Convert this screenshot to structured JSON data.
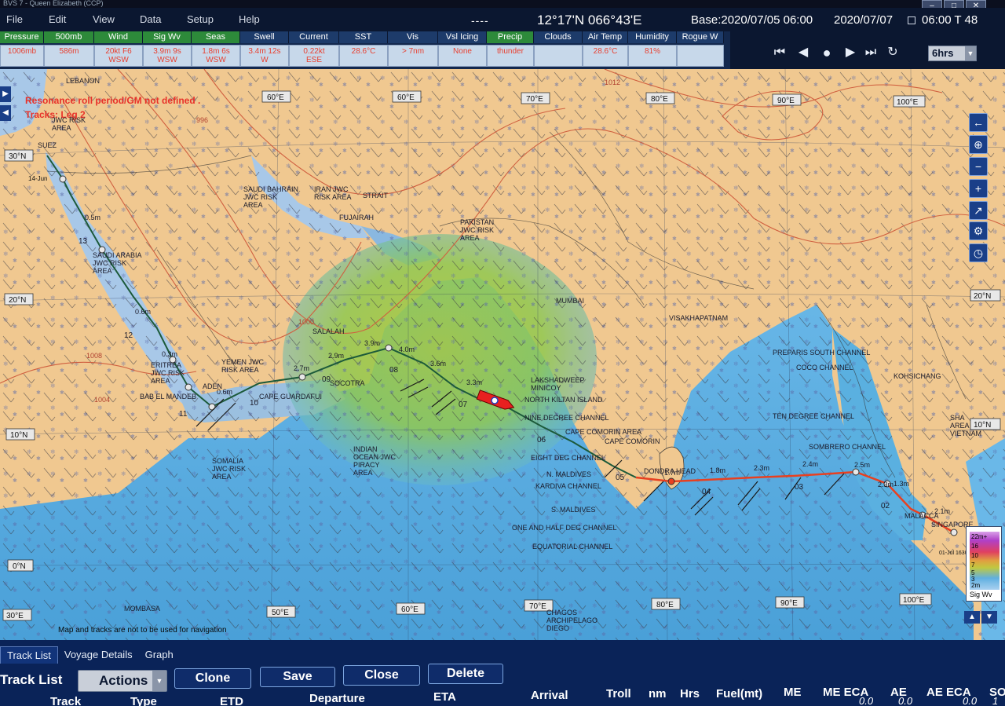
{
  "title_bar": {
    "text": "BVS 7 - Queen Elizabeth (CCP)",
    "buttons": [
      "–",
      "□",
      "✕"
    ]
  },
  "menu": [
    "File",
    "Edit",
    "View",
    "Data",
    "Setup",
    "Help"
  ],
  "status": {
    "indicator": "----",
    "position": "12°17'N 066°43'E",
    "base": "Base:2020/07/05 06:00",
    "date": "2020/07/07",
    "time": "06:00 T 48"
  },
  "params": [
    {
      "label": "Pressure",
      "value": "1006mb",
      "active": true
    },
    {
      "label": "500mb",
      "value": "586m",
      "active": true
    },
    {
      "label": "Wind",
      "value": "20kt F6\nWSW",
      "active": true
    },
    {
      "label": "Sig Wv",
      "value": "3.9m 9s\nWSW",
      "active": true
    },
    {
      "label": "Seas",
      "value": "1.8m 6s\nWSW",
      "active": true
    },
    {
      "label": "Swell",
      "value": "3.4m 12s\nW",
      "active": false
    },
    {
      "label": "Current",
      "value": "0.22kt\nESE",
      "active": false
    },
    {
      "label": "SST",
      "value": "28.6°C",
      "active": false
    },
    {
      "label": "Vis",
      "value": "> 7nm",
      "active": false
    },
    {
      "label": "Vsl Icing",
      "value": "None",
      "active": false
    },
    {
      "label": "Precip",
      "value": "thunder",
      "active": true
    },
    {
      "label": "Clouds",
      "value": "",
      "active": false
    },
    {
      "label": "Air Temp",
      "value": "28.6°C",
      "active": false
    },
    {
      "label": "Humidity",
      "value": "81%",
      "active": false
    },
    {
      "label": "Rogue W",
      "value": "",
      "active": false
    }
  ],
  "playback": {
    "step": "6hrs"
  },
  "map": {
    "warnings": [
      "Resonance roll period/GM not defined .",
      "Tracks: Leg 2"
    ],
    "footer_note": "Map and tracks are not to be used for navigation",
    "lon_labels": [
      "60°E",
      "60°E",
      "70°E",
      "80°E",
      "90°E",
      "100°E"
    ],
    "lon_labels_bottom": [
      "50°E",
      "60°E",
      "70°E",
      "80°E",
      "90°E",
      "100°E"
    ],
    "lat_labels": [
      "30°N",
      "20°N",
      "10°N",
      "0°N",
      "30°E"
    ],
    "lat_labels_right": [
      "20°N",
      "10°N"
    ],
    "places": [
      {
        "name": "LEBANON",
        "icon": "place"
      },
      {
        "name": "JWC RISK\nAREA"
      },
      {
        "name": "SUEZ"
      },
      {
        "name": "SAUDI BAHRAIN\nJWC RISK\nAREA"
      },
      {
        "name": "IRAN JWC\nRISK AREA"
      },
      {
        "name": "STRAIT"
      },
      {
        "name": "FUJAIRAH"
      },
      {
        "name": "PAKISTAN\nJWC RISK\nAREA"
      },
      {
        "name": "SAUDI ARABIA\nJWC RISK\nAREA"
      },
      {
        "name": "MUMBAI"
      },
      {
        "name": "VISAKHAPATNAM"
      },
      {
        "name": "SALALAH"
      },
      {
        "name": "YEMEN JWC\nRISK AREA"
      },
      {
        "name": "ERITREA\nJWC RISK\nAREA"
      },
      {
        "name": "BAB EL MANDEB"
      },
      {
        "name": "ADEN"
      },
      {
        "name": "SOCOTRA"
      },
      {
        "name": "CAPE GUARDAFUI"
      },
      {
        "name": "LAKSHADWEEP\nMINICOY"
      },
      {
        "name": "NORTH KILTAN ISLAND"
      },
      {
        "name": "NINE DEGREE CHANNEL"
      },
      {
        "name": "CAPE COMORIN AREA"
      },
      {
        "name": "CAPE COMORIN"
      },
      {
        "name": "EIGHT DEG CHANNEL"
      },
      {
        "name": "N. MALDIVES"
      },
      {
        "name": "KARDIVA CHANNEL"
      },
      {
        "name": "S. MALDIVES"
      },
      {
        "name": "ONE AND HALF DEG CHANNEL"
      },
      {
        "name": "EQUATORIAL CHANNEL"
      },
      {
        "name": "CHAGOS\nARCHIPELAGO\nDIEGO"
      },
      {
        "name": "SOMALIA\nJWC RISK\nAREA"
      },
      {
        "name": "INDIAN\nOCEAN JWC\nPIRACY\nAREA"
      },
      {
        "name": "PREPARIS SOUTH CHANNEL"
      },
      {
        "name": "COCO CHANNEL"
      },
      {
        "name": "TEN DEGREE CHANNEL"
      },
      {
        "name": "SOMBRERO CHANNEL"
      },
      {
        "name": "KOHSICHANG"
      },
      {
        "name": "SHA\nAREA\nVIETNAM"
      },
      {
        "name": "SINGAPORE"
      },
      {
        "name": "MALACCA"
      },
      {
        "name": "DONDRA HEAD"
      },
      {
        "name": "MOMBASA"
      }
    ],
    "leg_numbers": [
      "13",
      "12",
      "11",
      "10",
      "09",
      "08",
      "07",
      "06",
      "05",
      "04",
      "03",
      "02"
    ],
    "wave_labels": [
      "0.5m",
      "0.6m",
      "0.3m",
      "0.6m",
      "2.9m",
      "3.9m",
      "4.0m",
      "3.6m",
      "3.3m",
      "2.7m",
      "2.3m",
      "1.8m",
      "1.7m",
      "2.3m",
      "2.4m",
      "2.5m",
      "1.3m",
      "2.1m"
    ],
    "track_date_start": "14-Jun",
    "track_date_end": "01-Jul 1630",
    "isobars": [
      "1012",
      "1000",
      "996",
      "1008",
      "1004"
    ]
  },
  "legend": {
    "title": "Sig Wv",
    "ticks": [
      "22m+",
      "16",
      "10",
      "7",
      "5",
      "3",
      "2m"
    ]
  },
  "bottom": {
    "tabs": [
      "Track List",
      "Voyage Details",
      "Graph"
    ],
    "active_tab": "Track List",
    "panel_title": "Track List",
    "actions_label": "Actions",
    "buttons": [
      "Clone",
      "Save",
      "Close",
      "Delete"
    ],
    "columns": [
      "Track",
      "Type",
      "ETD",
      "Departure",
      "ETA",
      "Arrival",
      "Troll",
      "nm",
      "Hrs",
      "Fuel(mt)",
      "ME",
      "ME ECA",
      "AE",
      "AE ECA",
      "SO"
    ],
    "row_values": [
      "0.0",
      "0.0",
      "0.0",
      "1"
    ]
  },
  "colors": {
    "land": "#f0c890",
    "sea_mid": "#5ab0e0",
    "sea_high": "#b8cf40",
    "route_green": "#1c5a3a",
    "route_red": "#e84020",
    "isobar": "#d06040"
  }
}
